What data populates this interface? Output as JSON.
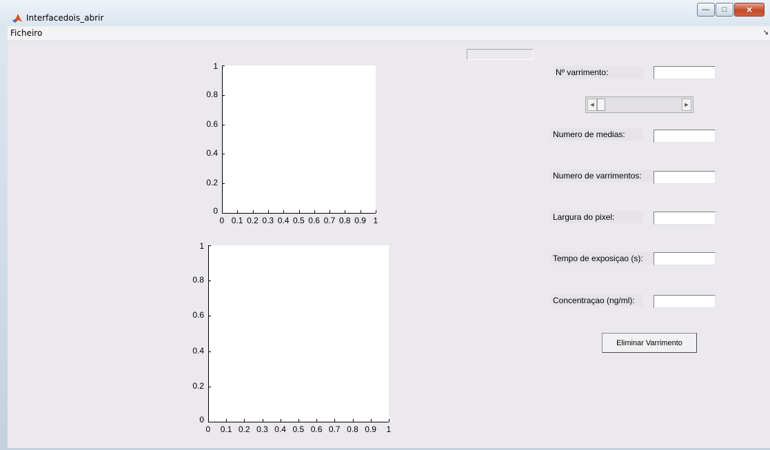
{
  "window": {
    "title": "Interfacedois_abrir"
  },
  "menu": {
    "file": "Ficheiro"
  },
  "controls": {
    "scan_no_label": "Nº varrimento:",
    "num_means_label": "Numero de medias:",
    "num_scans_label": "Numero de varrimentos:",
    "pixel_width_label": "Largura do pixel:",
    "exposure_label": "Tempo de exposiçao (s):",
    "concentration_label": "Concentraçao (ng/ml):",
    "delete_button": "Eliminar Varrimento",
    "scan_no_value": "",
    "num_means_value": "",
    "num_scans_value": "",
    "pixel_width_value": "",
    "exposure_value": "",
    "concentration_value": "",
    "status_value": ""
  },
  "chart_data": [
    {
      "type": "line",
      "title": "",
      "xlabel": "",
      "ylabel": "",
      "xlim": [
        0,
        1
      ],
      "ylim": [
        0,
        1
      ],
      "xticks": [
        "0",
        "0.1",
        "0.2",
        "0.3",
        "0.4",
        "0.5",
        "0.6",
        "0.7",
        "0.8",
        "0.9",
        "1"
      ],
      "yticks": [
        "0",
        "0.2",
        "0.4",
        "0.6",
        "0.8",
        "1"
      ],
      "series": []
    },
    {
      "type": "line",
      "title": "",
      "xlabel": "",
      "ylabel": "",
      "xlim": [
        0,
        1
      ],
      "ylim": [
        0,
        1
      ],
      "xticks": [
        "0",
        "0.1",
        "0.2",
        "0.3",
        "0.4",
        "0.5",
        "0.6",
        "0.7",
        "0.8",
        "0.9",
        "1"
      ],
      "yticks": [
        "0",
        "0.2",
        "0.4",
        "0.6",
        "0.8",
        "1"
      ],
      "series": []
    }
  ],
  "colors": {
    "background": "#ece9ee",
    "axes_background": "#ffffff"
  },
  "icons": {
    "app": "matlab-icon",
    "minimize": "minimize-icon",
    "maximize": "maximize-icon",
    "close": "close-icon"
  }
}
